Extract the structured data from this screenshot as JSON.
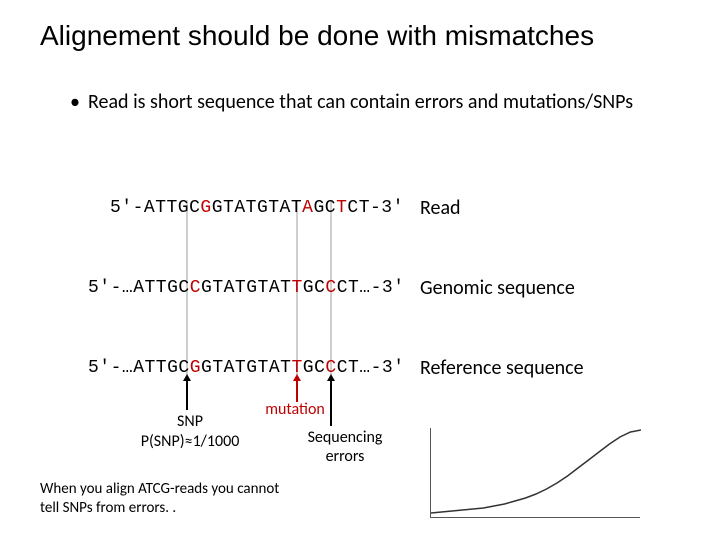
{
  "title": "Alignement should be done with mismatches",
  "bullet": "Read is short sequence that can contain errors and mutations/SNPs",
  "seq": {
    "read": {
      "pre": "5'-ATTGC",
      "m1": "G",
      "mid": "GTATGTAT",
      "m2": "A",
      "post1": "GC",
      "m3": "T",
      "post2": "CT-3'"
    },
    "genomic": {
      "pre": "5'-…ATTGC",
      "m1": "C",
      "mid": "GTATGTAT",
      "m2": "T",
      "post1": "GC",
      "m3": "C",
      "post2": "CT…-3'"
    },
    "ref": {
      "pre": "5'-…ATTGC",
      "m1": "G",
      "mid": "GTATGTAT",
      "m2": "T",
      "post1": "GC",
      "m3": "C",
      "post2": "CT…-3'"
    }
  },
  "labels": {
    "read": "Read",
    "genomic": "Genomic sequence",
    "ref": "Reference sequence",
    "snp": "SNP",
    "snp_prob": "P(SNP)≈1/1000",
    "mutation": "mutation",
    "seqerr_line1": "Sequencing",
    "seqerr_line2": "errors"
  },
  "footnote": "When you align ATCG-reads you cannot tell SNPs from errors. .",
  "chart_data": {
    "type": "line",
    "title": "",
    "xlabel": "",
    "ylabel": "",
    "x": [
      0,
      1,
      2,
      3,
      4,
      5,
      6,
      7,
      8,
      9,
      10,
      11,
      12,
      13,
      14,
      15,
      16,
      17,
      18,
      19,
      20
    ],
    "values": [
      5,
      6,
      7,
      8,
      9,
      10,
      12,
      14,
      17,
      20,
      24,
      29,
      35,
      42,
      50,
      58,
      66,
      74,
      81,
      86,
      88
    ],
    "ylim": [
      0,
      90
    ],
    "xlim": [
      0,
      20
    ]
  }
}
